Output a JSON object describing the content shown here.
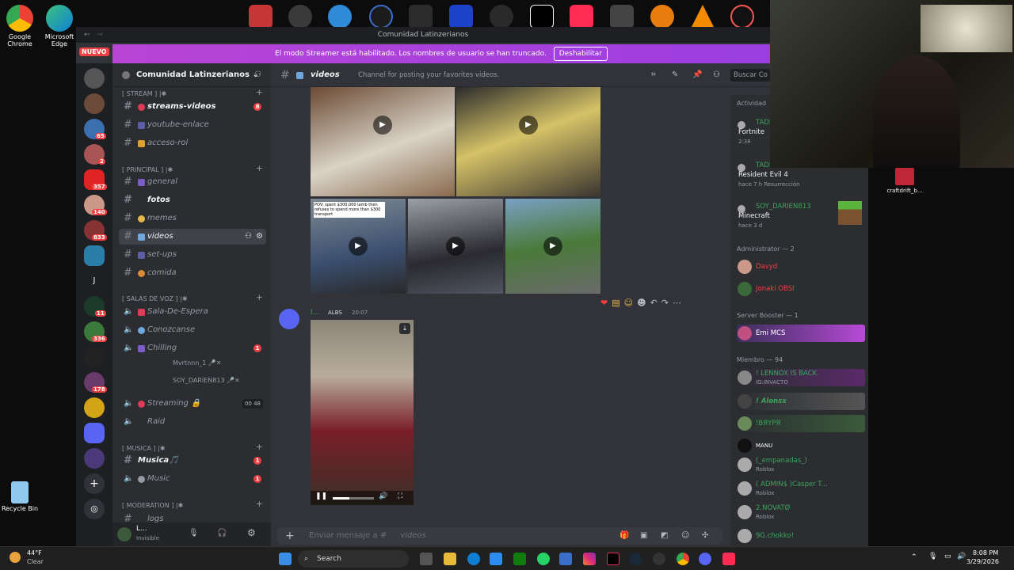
{
  "desktop": {
    "icons": [
      {
        "label": "Google\nChrome",
        "color": "#4285f4"
      },
      {
        "label": "Microsoft\nEdge",
        "color": "#0f7fd6"
      },
      {
        "label": "Recycle Bin",
        "color": "#5fb7e8"
      }
    ],
    "topbar_icons": [
      "#c63636",
      "#3a3a3a",
      "#2f8bd8",
      "#1b1b1b",
      "#2b2b2b",
      "#1d42c9",
      "#2a2a2a",
      "#000000",
      "#fe2c55",
      "#444444",
      "#e87d0d",
      "#f28b00",
      "#111111"
    ]
  },
  "window": {
    "title": "Comunidad Latinzerianos",
    "new_badge": "NUEVO"
  },
  "streamer_banner": {
    "text": "El modo Streamer está habilitado. Los nombres de usuario se han truncado.",
    "button": "Deshabilitar"
  },
  "guild_badges": [
    "65",
    "2",
    "357",
    "140",
    "833",
    "11",
    "336",
    "178"
  ],
  "server": {
    "name": "Comunidad Latinzerianos"
  },
  "categories": {
    "stream": "[ STREAM ] |✱",
    "principal": "[ PRINCIPAL ] |✱",
    "voz": "[ SALAS DE VOZ ] |✱",
    "musica": "[ MUSICA ] |✱",
    "moderation": "[ MODERATION ] |✱"
  },
  "channels": {
    "streams_videos": "streams-videos",
    "streams_badge": "8",
    "youtube": "youtube-enlace",
    "acceso": "acceso-rol",
    "general": "general",
    "fotos": "fotos",
    "memes": "memes",
    "videos": "videos",
    "setups": "set-ups",
    "comida": "comida",
    "sala": "Sala-De-Espera",
    "conoz": "Conozcanse",
    "chilling": "Chilling",
    "chilling_badge": "1",
    "streaming": "Streaming 🔒",
    "streaming_count": "00 48",
    "raid": "Raid",
    "musica": "Musica🎵",
    "musica_badge": "1",
    "music": "Music",
    "music_badge": "1",
    "logs": "logs"
  },
  "voice_users": [
    "Mvrtnnn_1 🎤✕",
    "SOY_DARIEN813 🎤✕"
  ],
  "user_panel": {
    "name": "L...",
    "status": "Invisible"
  },
  "chat": {
    "channel": "videos",
    "topic": "Channel for posting your favorites videos.",
    "search": "Buscar Co",
    "message_author": "l...",
    "message_tag": "ALBS",
    "message_time": "20:07",
    "thumb_caption": "POV: spent $300,000 lamb then refuses to spend more than $300 transport",
    "composer_placeholder": "Enviar mensaje a #",
    "composer_channel": "videos"
  },
  "activity": {
    "header": "Actividad",
    "items": [
      {
        "name": "TADEO",
        "game": "Fortnite",
        "time": "2:38"
      },
      {
        "name": "TADEO",
        "game": "Resident Evil 4",
        "time": "hace 7 h  Resurrección"
      },
      {
        "name": "SOY_DARIEN813",
        "game": "Minecraft",
        "time": "hace 3 d"
      }
    ]
  },
  "member_sections": {
    "admin": "Administrator — 2",
    "booster": "Server Booster — 1",
    "member": "Miembro — 94"
  },
  "members": {
    "admins": [
      {
        "name": "Davyd",
        "color": "#f23f43"
      },
      {
        "name": "Jonaki  OBSI",
        "color": "#f23f43"
      }
    ],
    "booster": {
      "name": "Emi  MCS",
      "color": "#ffffff"
    },
    "list": [
      {
        "name": "! LENNOX IS BACK",
        "sub": "IG:INVACTO",
        "color": "#3ba55c"
      },
      {
        "name": "! Alonsx",
        "sub": "",
        "color": "#3ba55c"
      },
      {
        "name": "!BЯYPЯ",
        "sub": "",
        "color": "#3ba55c"
      },
      {
        "name": "MANU",
        "sub": "",
        "color": "#ffffff"
      },
      {
        "name": "(_empanadas_)",
        "sub": "Roblox",
        "color": "#3ba55c"
      },
      {
        "name": "( ADMIN$ )Casper T...",
        "sub": "Roblox",
        "color": "#3ba55c"
      },
      {
        "name": "2.NOVATØ",
        "sub": "Roblox",
        "color": "#3ba55c"
      },
      {
        "name": "9G.chokko!",
        "sub": "",
        "color": "#3ba55c"
      }
    ]
  },
  "webcam_overlay": {
    "file": "craftdrift_b..."
  },
  "taskbar": {
    "weather": "44°F",
    "weather_desc": "Clear",
    "search": "Search",
    "time": "8:08 PM",
    "date": "3/29/2026"
  }
}
